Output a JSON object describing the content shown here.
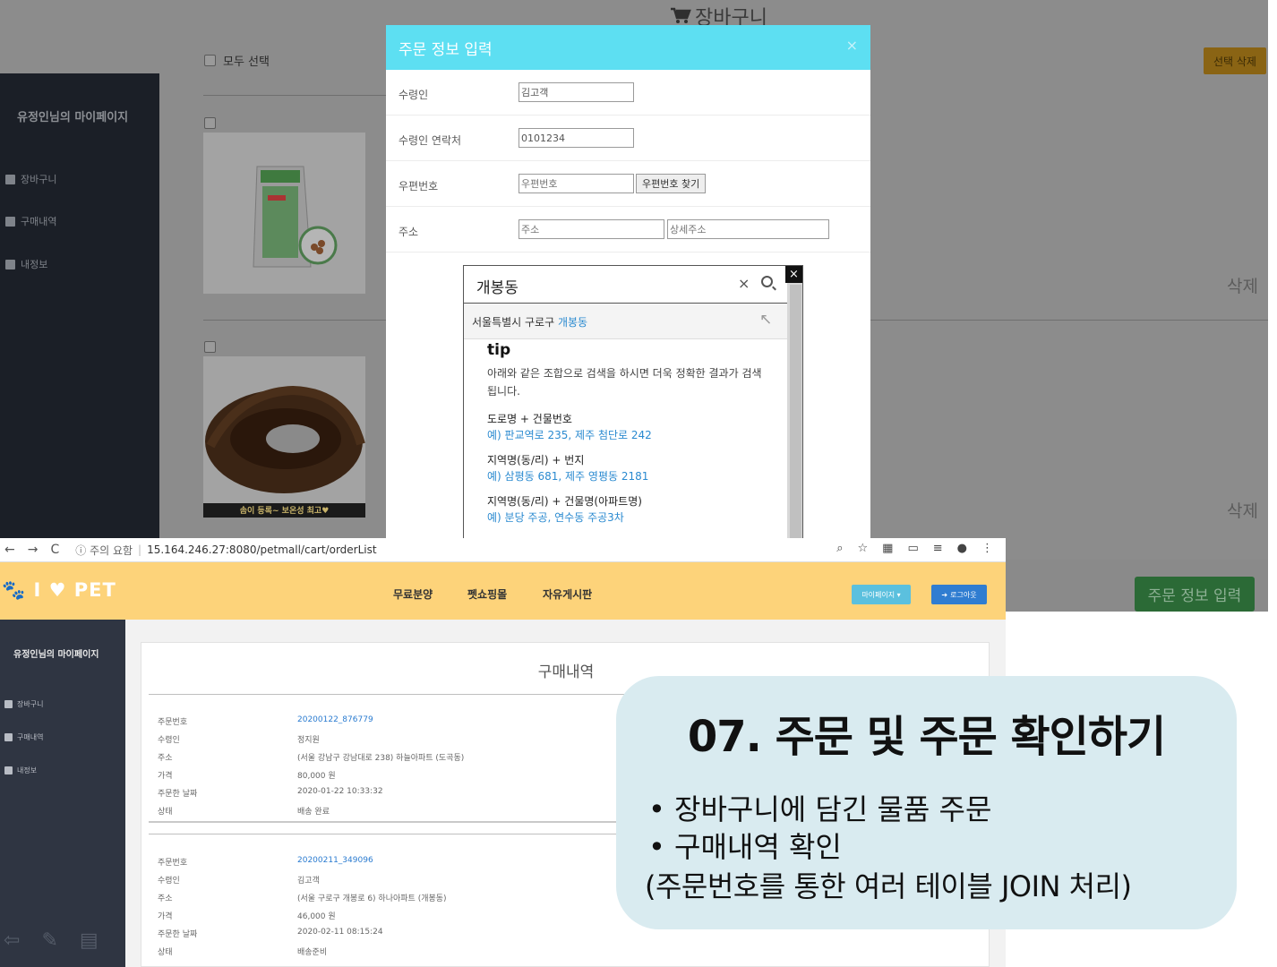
{
  "top": {
    "cart_title": "장바구니",
    "select_all": "모두 선택",
    "delete_selected": "선택 삭제",
    "sidebar": {
      "title": "유정인님의 마이페이지",
      "items": [
        {
          "label": "장바구니"
        },
        {
          "label": "구매내역"
        },
        {
          "label": "내정보"
        }
      ]
    },
    "products": [
      {
        "delete_label": "삭제",
        "caption": ""
      },
      {
        "delete_label": "삭제",
        "caption": "솜이 등록~ 보온성 최고♥"
      }
    ],
    "order_button": "주문 정보 입력"
  },
  "modal": {
    "title": "주문 정보 입력",
    "close": "×",
    "fields": {
      "recipient_label": "수령인",
      "recipient_value": "김고객",
      "phone_label": "수령인 연락처",
      "phone_value": "0101234",
      "zip_label": "우편번호",
      "zip_placeholder": "우편번호",
      "zip_button": "우편번호 찾기",
      "address_label": "주소",
      "address_placeholder": "주소",
      "address_detail_placeholder": "상세주소"
    }
  },
  "postcode": {
    "close": "×",
    "query": "개봉동",
    "clear_icon": "×",
    "suggestion_prefix": "서울특별시 구로구 ",
    "suggestion_highlight": "개봉동",
    "suggestion_arrow": "↖",
    "tip_title": "tip",
    "tip_desc": "아래와 같은 조합으로 검색을 하시면 더욱 정확한 결과가 검색됩니다.",
    "groups": [
      {
        "title": "도로명 + 건물번호",
        "example": "예) 판교역로 235,  제주 첨단로 242"
      },
      {
        "title": "지역명(동/리) + 번지",
        "example": "예) 삼평동 681,  제주 영평동 2181"
      },
      {
        "title": "지역명(동/리) + 건물명(아파트명)",
        "example": "예) 분당 주공,  연수동 주공3차"
      }
    ]
  },
  "browser": {
    "back": "←",
    "forward": "→",
    "reload": "C",
    "security": "ⓘ 주의 요함",
    "url": "15.164.246.27:8080/petmall/cart/orderList"
  },
  "site": {
    "logo": "🐾 I ♥ PET",
    "nav": [
      "무료분양",
      "펫쇼핑몰",
      "자유게시판"
    ],
    "mypage": "마이페이지 ▾",
    "logout": "로그아웃",
    "sidebar": {
      "title": "유정인님의 마이페이지",
      "items": [
        {
          "label": "장바구니"
        },
        {
          "label": "구매내역"
        },
        {
          "label": "내정보"
        }
      ]
    },
    "page_title": "구매내역",
    "orders": [
      {
        "rows": [
          {
            "k": "주문번호",
            "v": "20200122_876779"
          },
          {
            "k": "수령인",
            "v": "정지원"
          },
          {
            "k": "주소",
            "v": "(서울 강남구 강남대로 238) 하늘아파트 (도곡동)"
          },
          {
            "k": "가격",
            "v": "80,000 원"
          },
          {
            "k": "주문한 날짜",
            "v": "2020-01-22 10:33:32"
          },
          {
            "k": "상태",
            "v": "배송 완료"
          }
        ]
      },
      {
        "rows": [
          {
            "k": "주문번호",
            "v": "20200211_349096"
          },
          {
            "k": "수령인",
            "v": "김고객"
          },
          {
            "k": "주소",
            "v": "(서울 구로구 개봉로 6) 하나아파트 (개봉동)"
          },
          {
            "k": "가격",
            "v": "46,000 원"
          },
          {
            "k": "주문한 날짜",
            "v": "2020-02-11 08:15:24"
          },
          {
            "k": "상태",
            "v": "배송준비"
          }
        ]
      }
    ]
  },
  "callout": {
    "title": "07. 주문 및 주문 확인하기",
    "bullets": [
      "장바구니에 담긴 물품 주문",
      "구매내역 확인"
    ],
    "note": "(주문번호를 통한 여러 테이블 JOIN 처리)"
  },
  "colors": {
    "modal_header": "#5ddff2",
    "site_header": "#fdd37a",
    "callout_bg": "#d9ebf0",
    "link": "#2a7bd0"
  }
}
